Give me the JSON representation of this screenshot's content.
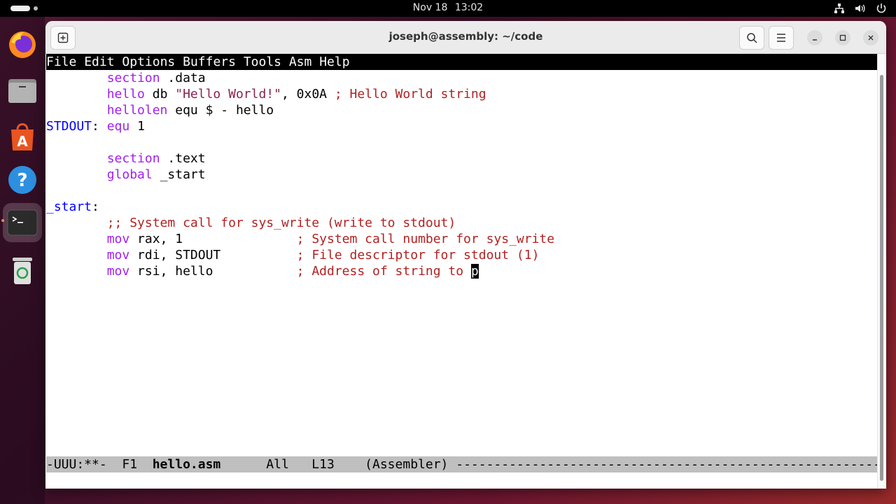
{
  "topbar": {
    "date": "Nov 18",
    "time": "13:02",
    "tray_icons": [
      "network-icon",
      "volume-icon",
      "power-icon"
    ]
  },
  "dock": {
    "items": [
      {
        "name": "firefox",
        "icon": "firefox-icon"
      },
      {
        "name": "files",
        "icon": "files-icon"
      },
      {
        "name": "app-center",
        "icon": "app-center-icon"
      },
      {
        "name": "help",
        "icon": "help-icon"
      },
      {
        "name": "terminal",
        "icon": "terminal-icon",
        "active": true
      },
      {
        "name": "trash",
        "icon": "trash-icon"
      }
    ]
  },
  "window": {
    "title": "joseph@assembly: ~/code"
  },
  "emacs": {
    "menu": [
      "File",
      "Edit",
      "Options",
      "Buffers",
      "Tools",
      "Asm",
      "Help"
    ],
    "code": {
      "l1_kw": "section",
      "l1_rest": " .data",
      "l2_kw": "hello",
      "l2_mid": " db ",
      "l2_str": "\"Hello World!\"",
      "l2_mid2": ", 0x0A ",
      "l2_cm": "; Hello World string",
      "l3_kw": "hellolen",
      "l3_rest": " equ $ - hello",
      "l4_lbl": "STDOUT",
      "l4_colon": ": ",
      "l4_kw": "equ",
      "l4_rest": " 1",
      "l6_kw": "section",
      "l6_rest": " .text",
      "l7_kw": "global",
      "l7_rest": " _start",
      "l9_lbl": "_start",
      "l9_colon": ":",
      "l10_cm": ";; System call for sys_write (write to stdout)",
      "l11_kw": "mov",
      "l11_rest": " rax, 1               ",
      "l11_cm": "; System call number for sys_write",
      "l12_kw": "mov",
      "l12_rest": " rdi, STDOUT          ",
      "l12_cm": "; File descriptor for stdout (1)",
      "l13_kw": "mov",
      "l13_rest": " rsi, hello           ",
      "l13_cm": "; Address of string to ",
      "l13_cursor": "p"
    },
    "modeline": {
      "status": "-UUU:**-  F1  ",
      "buffer": "hello.asm",
      "position": "      All   L13    ",
      "mode": "(Assembler)",
      "fill": " ----------------------------------------------------------------------------------------------------"
    }
  }
}
